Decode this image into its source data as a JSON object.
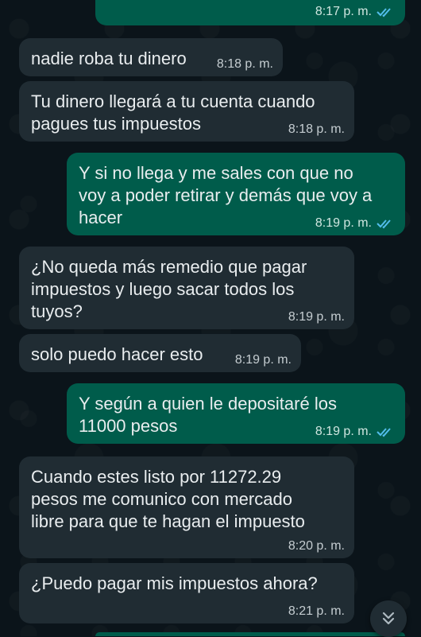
{
  "messages": [
    {
      "dir": "out",
      "text": "",
      "time": "8:17 p. m.",
      "read": true
    },
    {
      "dir": "in",
      "text": "nadie roba tu dinero",
      "time": "8:18 p. m."
    },
    {
      "dir": "in",
      "text": "Tu dinero llegará a tu cuenta cuando\npagues tus impuestos",
      "time": "8:18 p. m."
    },
    {
      "dir": "out",
      "text": "Y si no llega y me sales con que no\nvoy a poder retirar y demás que voy a\nhacer",
      "time": "8:19 p. m.",
      "read": true
    },
    {
      "dir": "in",
      "text": "¿No queda más remedio que pagar\nimpuestos y luego sacar todos los\ntuyos?",
      "time": "8:19 p. m."
    },
    {
      "dir": "in",
      "text": "solo puedo hacer esto",
      "time": "8:19 p. m."
    },
    {
      "dir": "out",
      "text": "Y según a quien le depositaré los\n11000 pesos",
      "time": "8:19 p. m.",
      "read": true
    },
    {
      "dir": "in",
      "text": "Cuando estes listo por 11272.29\npesos me comunico con mercado\nlibre para que te hagan el impuesto",
      "time": "8:20 p. m."
    },
    {
      "dir": "in",
      "text": "¿Puedo pagar mis impuestos ahora?",
      "time": "8:21 p. m."
    }
  ],
  "icons": {
    "read_receipt": "double-check-icon",
    "scroll_down": "double-chevron-down-icon"
  },
  "colors": {
    "background": "#0b141a",
    "incoming_bubble": "#202c33",
    "outgoing_bubble": "#005c4b",
    "read_tick": "#53bdeb"
  }
}
